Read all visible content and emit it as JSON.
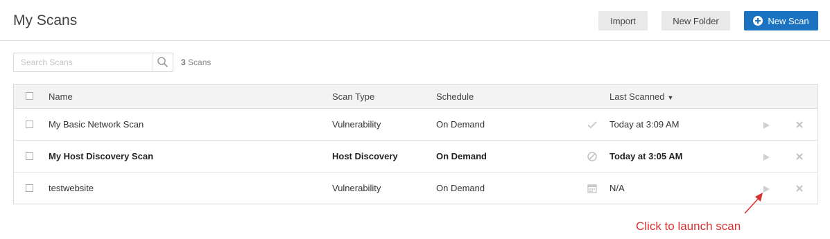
{
  "header": {
    "title": "My Scans",
    "import_label": "Import",
    "new_folder_label": "New Folder",
    "new_scan_label": "New Scan"
  },
  "search": {
    "placeholder": "Search Scans",
    "value": ""
  },
  "scan_count": {
    "number": "3",
    "unit": "Scans"
  },
  "table": {
    "columns": {
      "name": "Name",
      "scan_type": "Scan Type",
      "schedule": "Schedule",
      "last_scanned": "Last Scanned",
      "sort_indicator": "▼"
    },
    "rows": [
      {
        "name": "My Basic Network Scan",
        "scan_type": "Vulnerability",
        "schedule": "On Demand",
        "status_icon": "check-icon",
        "last_scanned": "Today at 3:09 AM",
        "bold": false
      },
      {
        "name": "My Host Discovery Scan",
        "scan_type": "Host Discovery",
        "schedule": "On Demand",
        "status_icon": "canceled-icon",
        "last_scanned": "Today at 3:05 AM",
        "bold": true
      },
      {
        "name": "testwebsite",
        "scan_type": "Vulnerability",
        "schedule": "On Demand",
        "status_icon": "calendar-icon",
        "last_scanned": "N/A",
        "bold": false
      }
    ]
  },
  "annotation": {
    "text": "Click to launch scan",
    "color": "#d93030"
  },
  "colors": {
    "accent": "#1a72c0",
    "header_bg": "#f3f3f3"
  }
}
